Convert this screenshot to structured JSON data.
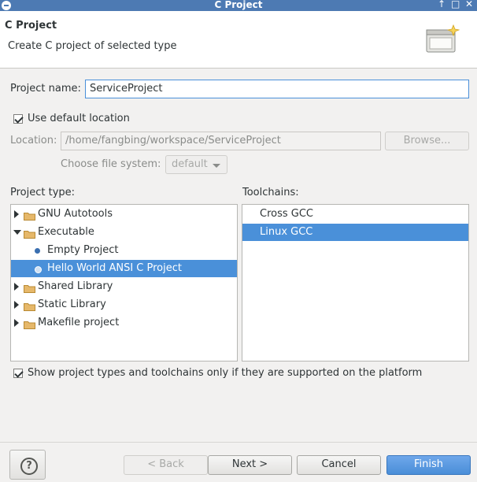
{
  "window": {
    "title": "C Project"
  },
  "header": {
    "title": "C Project",
    "subtitle": "Create C project of selected type"
  },
  "form": {
    "project_name_label": "Project name:",
    "project_name_value": "ServiceProject",
    "use_default_location_label": "Use default location",
    "use_default_location_checked": true,
    "location_label": "Location:",
    "location_value": "/home/fangbing/workspace/ServiceProject",
    "browse_label": "Browse...",
    "file_system_label": "Choose file system:",
    "file_system_value": "default"
  },
  "project_types": {
    "label": "Project type:",
    "items": [
      {
        "label": "GNU Autotools",
        "kind": "folder",
        "expanded": false,
        "level": 0
      },
      {
        "label": "Executable",
        "kind": "folder",
        "expanded": true,
        "level": 0
      },
      {
        "label": "Empty Project",
        "kind": "leaf",
        "level": 1
      },
      {
        "label": "Hello World ANSI C Project",
        "kind": "leaf",
        "level": 1,
        "selected": true
      },
      {
        "label": "Shared Library",
        "kind": "folder",
        "expanded": false,
        "level": 0
      },
      {
        "label": "Static Library",
        "kind": "folder",
        "expanded": false,
        "level": 0
      },
      {
        "label": "Makefile project",
        "kind": "folder",
        "expanded": false,
        "level": 0
      }
    ]
  },
  "toolchains": {
    "label": "Toolchains:",
    "items": [
      {
        "label": "Cross GCC",
        "selected": false
      },
      {
        "label": "Linux GCC",
        "selected": true
      }
    ]
  },
  "filter": {
    "label": "Show project types and toolchains only if they are supported on the platform",
    "checked": true
  },
  "footer": {
    "help": "?",
    "back": "< Back",
    "next": "Next >",
    "cancel": "Cancel",
    "finish": "Finish"
  },
  "colors": {
    "titlebar": "#4d7ab3",
    "selection": "#4a90d9",
    "folder": "#e6b86a"
  },
  "icons": {
    "menu": "menu-icon",
    "maximize": "maximize-icon",
    "restore": "restore-icon",
    "close": "close-icon",
    "help": "help-icon"
  }
}
